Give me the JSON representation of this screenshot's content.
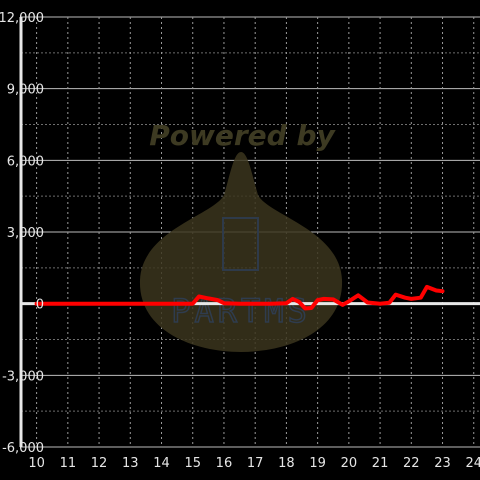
{
  "colors": {
    "background": "#000000",
    "series": "#ff0000",
    "grid": "#bdbdbd",
    "axis": "#e8e8e8",
    "watermark": "#3b351d"
  },
  "watermark": {
    "text": "Powered by",
    "subtext": "PARTMS"
  },
  "chart_data": {
    "type": "line",
    "x": [
      10,
      10.5,
      11,
      11.5,
      12,
      12.5,
      13,
      13.5,
      14,
      14.5,
      15,
      15.2,
      15.5,
      15.8,
      16,
      16.5,
      17,
      17.5,
      18,
      18.2,
      18.4,
      18.6,
      18.8,
      19,
      19.2,
      19.5,
      19.8,
      20,
      20.3,
      20.6,
      21,
      21.3,
      21.5,
      21.8,
      22,
      22.3,
      22.5,
      22.8,
      23
    ],
    "series": [
      {
        "values": [
          0,
          0,
          0,
          0,
          0,
          0,
          0,
          0,
          0,
          0,
          0,
          300,
          220,
          150,
          20,
          0,
          0,
          0,
          20,
          200,
          80,
          -200,
          -180,
          150,
          200,
          180,
          -50,
          100,
          350,
          50,
          0,
          40,
          380,
          250,
          200,
          250,
          700,
          550,
          520
        ]
      }
    ],
    "xlim": [
      9.5,
      24.2
    ],
    "ylim": [
      -6000,
      12000
    ],
    "xticks": [
      "10",
      "11",
      "12",
      "13",
      "14",
      "15",
      "16",
      "17",
      "18",
      "19",
      "20",
      "21",
      "22",
      "23",
      "24"
    ],
    "yticks": [
      "12,000",
      "9,000",
      "6,000",
      "3,000",
      "0",
      "-3,000",
      "-6,000"
    ],
    "ytick_values": [
      12000,
      9000,
      6000,
      3000,
      0,
      -3000,
      -6000
    ],
    "grid": true
  }
}
